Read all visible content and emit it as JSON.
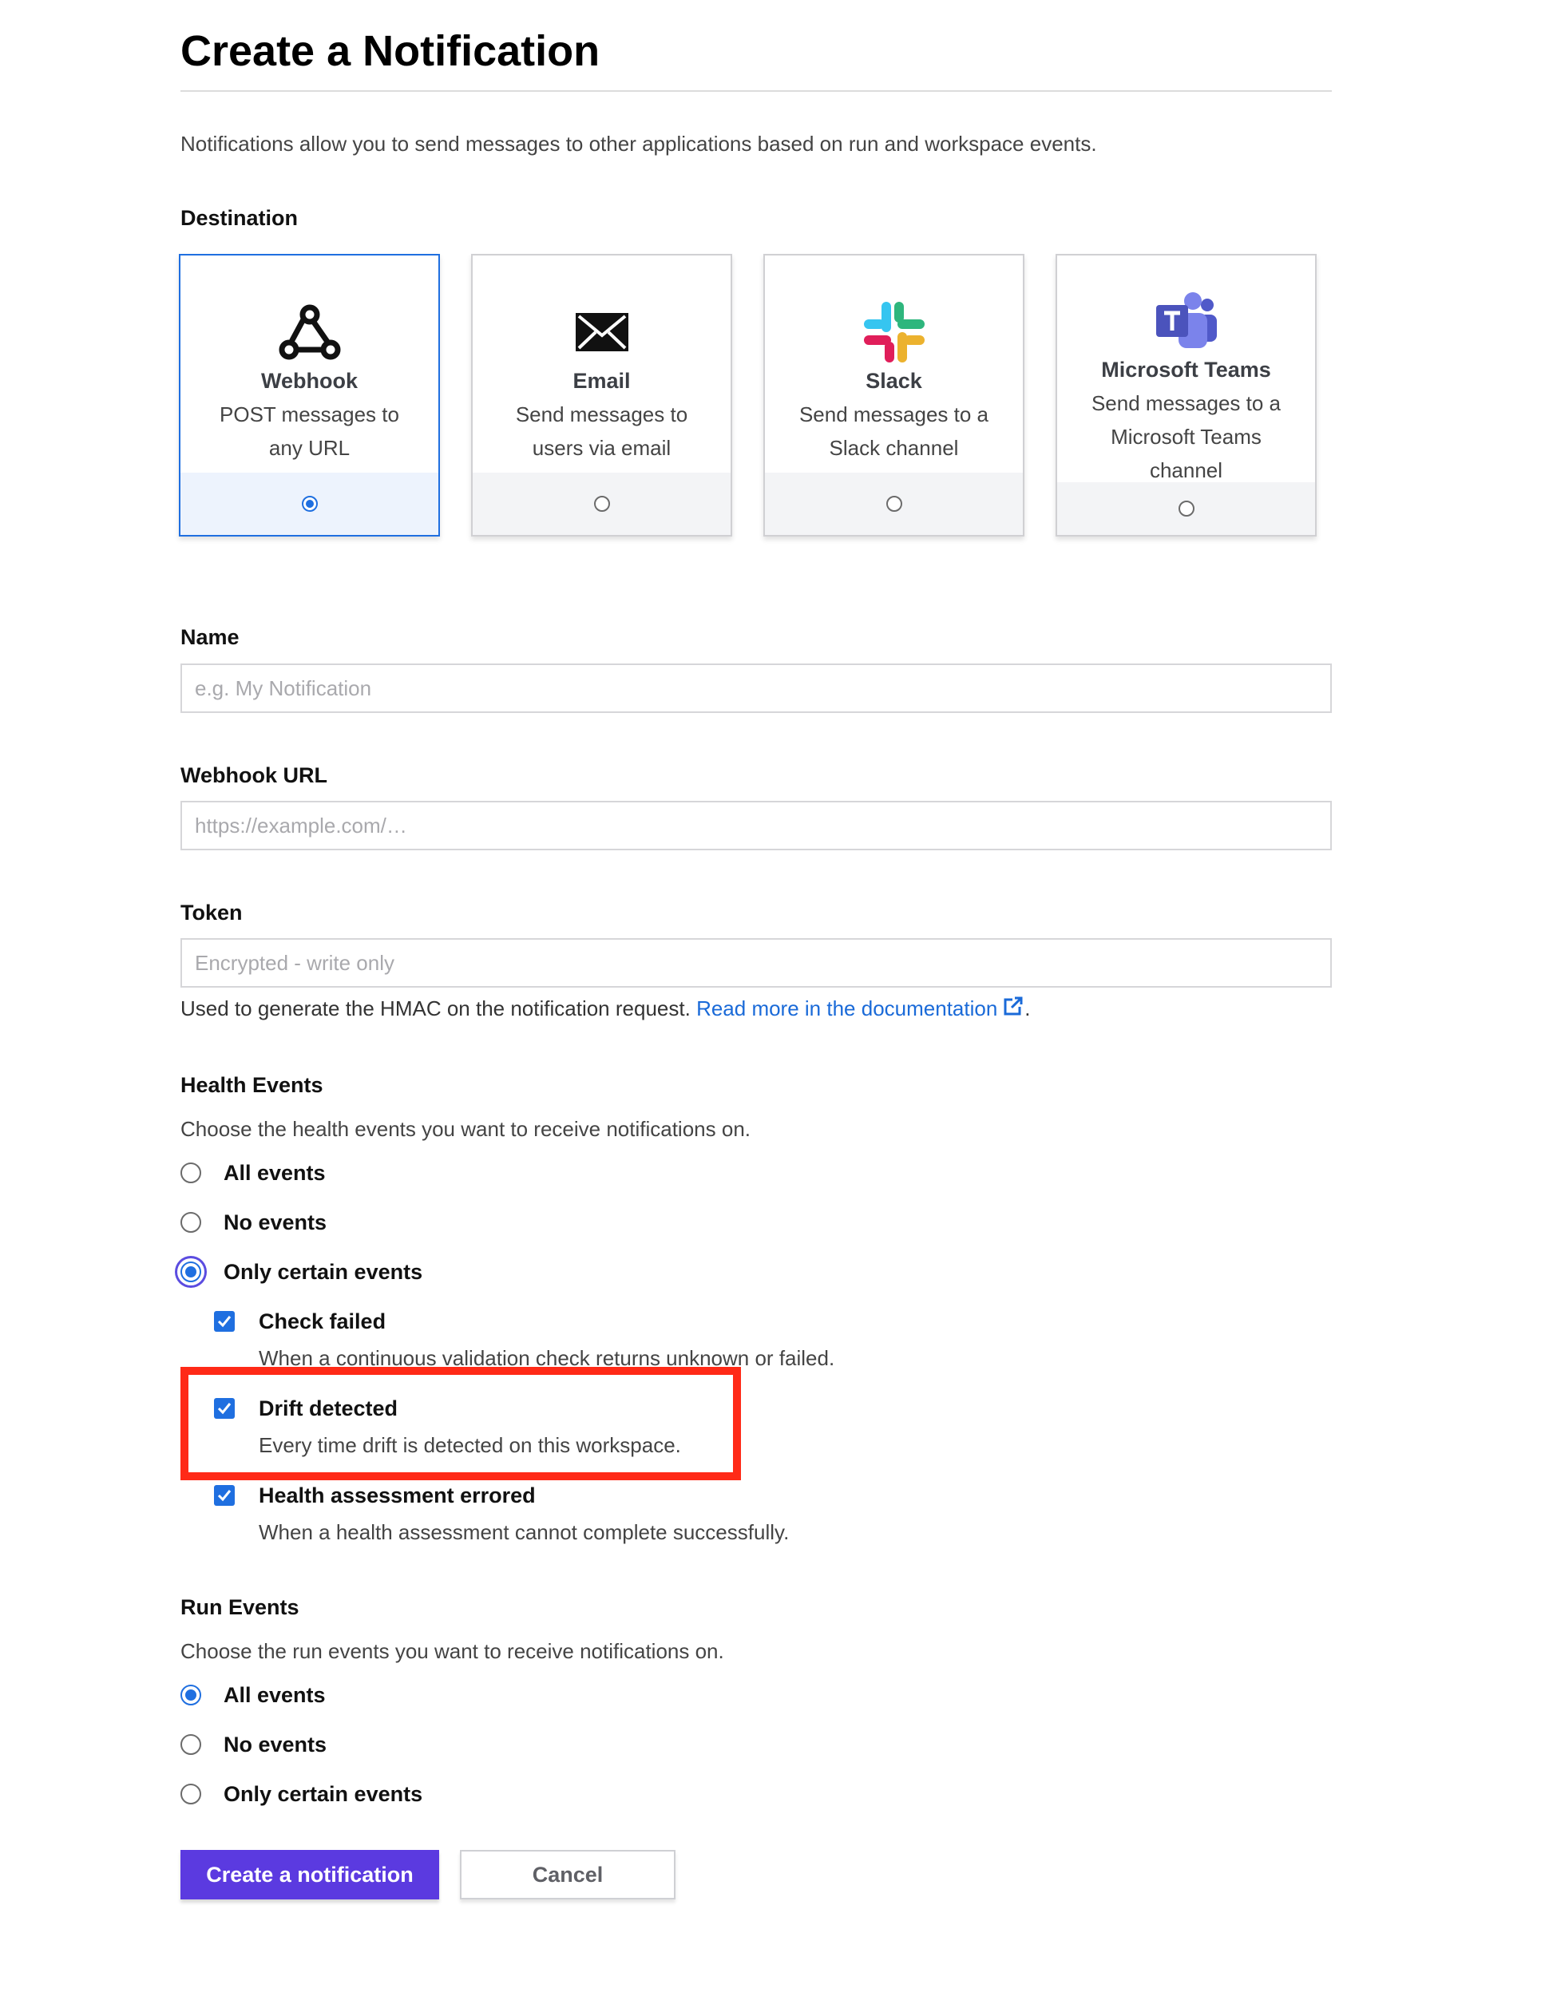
{
  "page": {
    "title": "Create a Notification",
    "intro": "Notifications allow you to send messages to other applications based on run and workspace events."
  },
  "destination": {
    "label": "Destination",
    "selected": "webhook",
    "options": [
      {
        "id": "webhook",
        "title": "Webhook",
        "desc_line1": "POST messages to",
        "desc_line2": "any URL",
        "icon": "webhook-icon"
      },
      {
        "id": "email",
        "title": "Email",
        "desc_line1": "Send messages to",
        "desc_line2": "users via email",
        "icon": "envelope-icon"
      },
      {
        "id": "slack",
        "title": "Slack",
        "desc_line1": "Send messages to a",
        "desc_line2": "Slack channel",
        "icon": "slack-icon"
      },
      {
        "id": "teams",
        "title": "Microsoft Teams",
        "desc_line1": "Send messages to a",
        "desc_line2": "Microsoft Teams",
        "desc_line3": "channel",
        "icon": "microsoft-teams-icon"
      }
    ]
  },
  "name_field": {
    "label": "Name",
    "placeholder": "e.g. My Notification",
    "value": ""
  },
  "url_field": {
    "label": "Webhook URL",
    "placeholder": "https://example.com/…",
    "value": ""
  },
  "token_field": {
    "label": "Token",
    "placeholder": "Encrypted - write only",
    "value": "",
    "help": "Used to generate the HMAC on the notification request.",
    "help_link": "Read more in the documentation",
    "help_end": "."
  },
  "health_events": {
    "heading": "Health Events",
    "description": "Choose the health events you want to receive notifications on.",
    "selected": "only_certain",
    "options": [
      {
        "id": "all",
        "label": "All events"
      },
      {
        "id": "none",
        "label": "No events"
      },
      {
        "id": "only_certain",
        "label": "Only certain events"
      }
    ],
    "checkboxes": [
      {
        "label": "Check failed",
        "desc": "When a continuous validation check returns unknown or failed.",
        "checked": true
      },
      {
        "label": "Drift detected",
        "desc": "Every time drift is detected on this workspace.",
        "checked": true
      },
      {
        "label": "Health assessment errored",
        "desc": "When a health assessment cannot complete successfully.",
        "checked": true
      }
    ]
  },
  "run_events": {
    "heading": "Run Events",
    "description": "Choose the run events you want to receive notifications on.",
    "selected": "all",
    "options": [
      {
        "id": "all",
        "label": "All events"
      },
      {
        "id": "none",
        "label": "No events"
      },
      {
        "id": "only_certain",
        "label": "Only certain events"
      }
    ]
  },
  "actions": {
    "submit_label": "Create a notification",
    "cancel_label": "Cancel"
  },
  "colors": {
    "primary": "#5b3ae0",
    "link": "#1a6ad8",
    "selected_border": "#1f6fe0",
    "annotation": "#ff2a17"
  }
}
